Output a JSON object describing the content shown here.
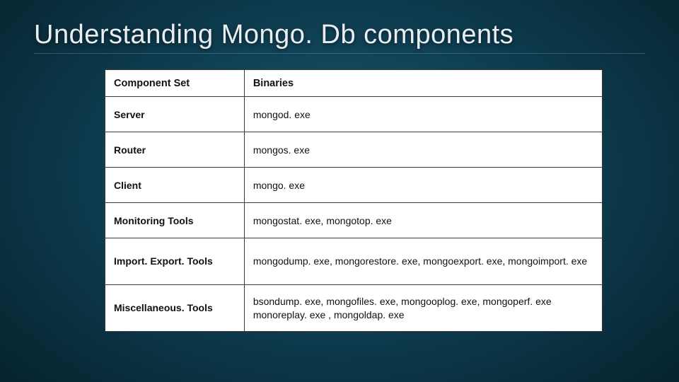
{
  "title": "Understanding Mongo. Db components",
  "table": {
    "headers": {
      "col1": "Component Set",
      "col2": "Binaries"
    },
    "rows": [
      {
        "component": "Server",
        "binaries": "mongod. exe",
        "size": "small"
      },
      {
        "component": "Router",
        "binaries": "mongos. exe",
        "size": "small"
      },
      {
        "component": "Client",
        "binaries": "mongo. exe",
        "size": "small"
      },
      {
        "component": "Monitoring Tools",
        "binaries": "mongostat. exe, mongotop. exe",
        "size": "small"
      },
      {
        "component": "Import. Export. Tools",
        "binaries": "mongodump. exe, mongorestore. exe, mongoexport. exe, mongoimport. exe",
        "size": "big"
      },
      {
        "component": "Miscellaneous. Tools",
        "binaries": "bsondump. exe, mongofiles. exe, mongooplog. exe, mongoperf. exe monoreplay. exe , mongoldap. exe",
        "size": "big"
      }
    ]
  }
}
